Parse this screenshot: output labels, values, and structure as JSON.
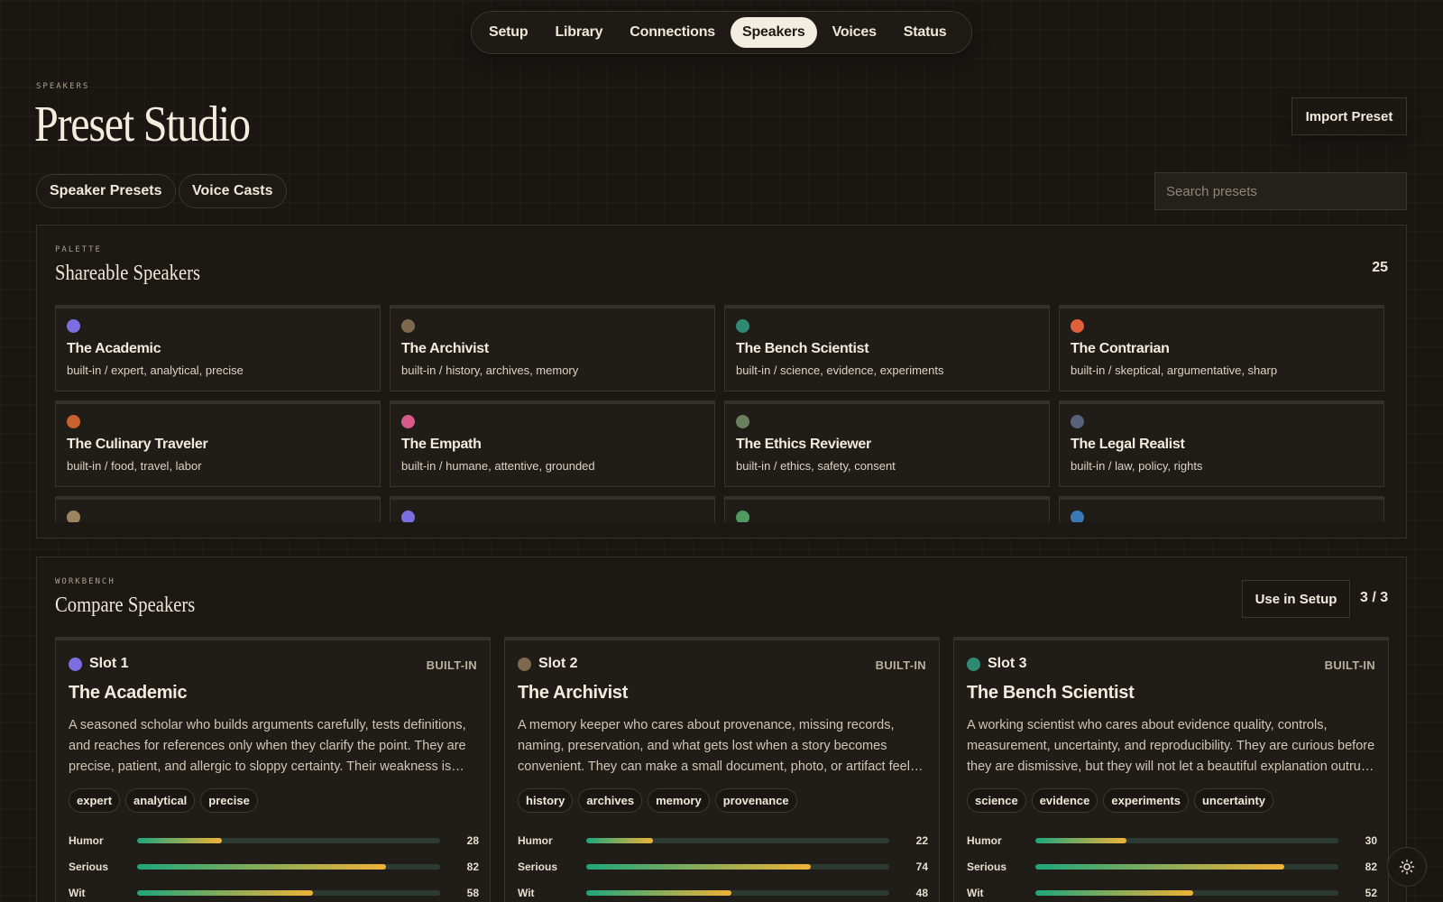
{
  "nav": {
    "tabs": [
      {
        "label": "Setup"
      },
      {
        "label": "Library"
      },
      {
        "label": "Connections"
      },
      {
        "label": "Speakers",
        "active": true
      },
      {
        "label": "Voices"
      },
      {
        "label": "Status"
      }
    ]
  },
  "header": {
    "eyebrow": "SPEAKERS",
    "title": "Preset Studio",
    "import_label": "Import Preset",
    "tabs": [
      "Speaker Presets",
      "Voice Casts"
    ],
    "search_placeholder": "Search presets"
  },
  "palette": {
    "eyebrow": "PALETTE",
    "title": "Shareable Speakers",
    "count": "25",
    "cards": [
      {
        "name": "The Academic",
        "tags": "built-in / expert, analytical, precise",
        "color": "#7b6ee0"
      },
      {
        "name": "The Archivist",
        "tags": "built-in / history, archives, memory",
        "color": "#7d6a4c"
      },
      {
        "name": "The Bench Scientist",
        "tags": "built-in / science, evidence, experiments",
        "color": "#2f8a74"
      },
      {
        "name": "The Contrarian",
        "tags": "built-in / skeptical, argumentative, sharp",
        "color": "#e0603a"
      },
      {
        "name": "The Culinary Traveler",
        "tags": "built-in / food, travel, labor",
        "color": "#c9612f"
      },
      {
        "name": "The Empath",
        "tags": "built-in / humane, attentive, grounded",
        "color": "#d75a8a"
      },
      {
        "name": "The Ethics Reviewer",
        "tags": "built-in / ethics, safety, consent",
        "color": "#6a7f5e"
      },
      {
        "name": "The Legal Realist",
        "tags": "built-in / law, policy, rights",
        "color": "#56627a"
      },
      {
        "name": "",
        "tags": "",
        "color": "#9a8560"
      },
      {
        "name": "",
        "tags": "",
        "color": "#7b6ee0"
      },
      {
        "name": "",
        "tags": "",
        "color": "#4f9a5e"
      },
      {
        "name": "",
        "tags": "",
        "color": "#3a78b8"
      }
    ]
  },
  "workbench": {
    "eyebrow": "WORKBENCH",
    "title": "Compare Speakers",
    "use_label": "Use in Setup",
    "count": "3 / 3",
    "slots": [
      {
        "slot": "Slot 1",
        "badge": "BUILT-IN",
        "name": "The Academic",
        "color": "#7b6ee0",
        "desc": "A seasoned scholar who builds arguments carefully, tests definitions, and reaches for references only when they clarify the point. They are precise, patient, and allergic to sloppy certainty. Their weakness is over-...",
        "tags": [
          "expert",
          "analytical",
          "precise"
        ],
        "stats": [
          {
            "label": "Humor",
            "value": 28
          },
          {
            "label": "Serious",
            "value": 82
          },
          {
            "label": "Wit",
            "value": 58
          }
        ]
      },
      {
        "slot": "Slot 2",
        "badge": "BUILT-IN",
        "name": "The Archivist",
        "color": "#7d6a4c",
        "desc": "A memory keeper who cares about provenance, missing records, naming, preservation, and what gets lost when a story becomes convenient. They can make a small document, photo, or artifact feel connected to a larger...",
        "tags": [
          "history",
          "archives",
          "memory",
          "provenance"
        ],
        "stats": [
          {
            "label": "Humor",
            "value": 22
          },
          {
            "label": "Serious",
            "value": 74
          },
          {
            "label": "Wit",
            "value": 48
          }
        ]
      },
      {
        "slot": "Slot 3",
        "badge": "BUILT-IN",
        "name": "The Bench Scientist",
        "color": "#2f8a74",
        "desc": "A working scientist who cares about evidence quality, controls, measurement, uncertainty, and reproducibility. They are curious before they are dismissive, but they will not let a beautiful explanation outrun th...",
        "tags": [
          "science",
          "evidence",
          "experiments",
          "uncertainty"
        ],
        "stats": [
          {
            "label": "Humor",
            "value": 30
          },
          {
            "label": "Serious",
            "value": 82
          },
          {
            "label": "Wit",
            "value": 52
          }
        ]
      }
    ]
  },
  "theme_toggle": {
    "icon": "sun-icon"
  }
}
